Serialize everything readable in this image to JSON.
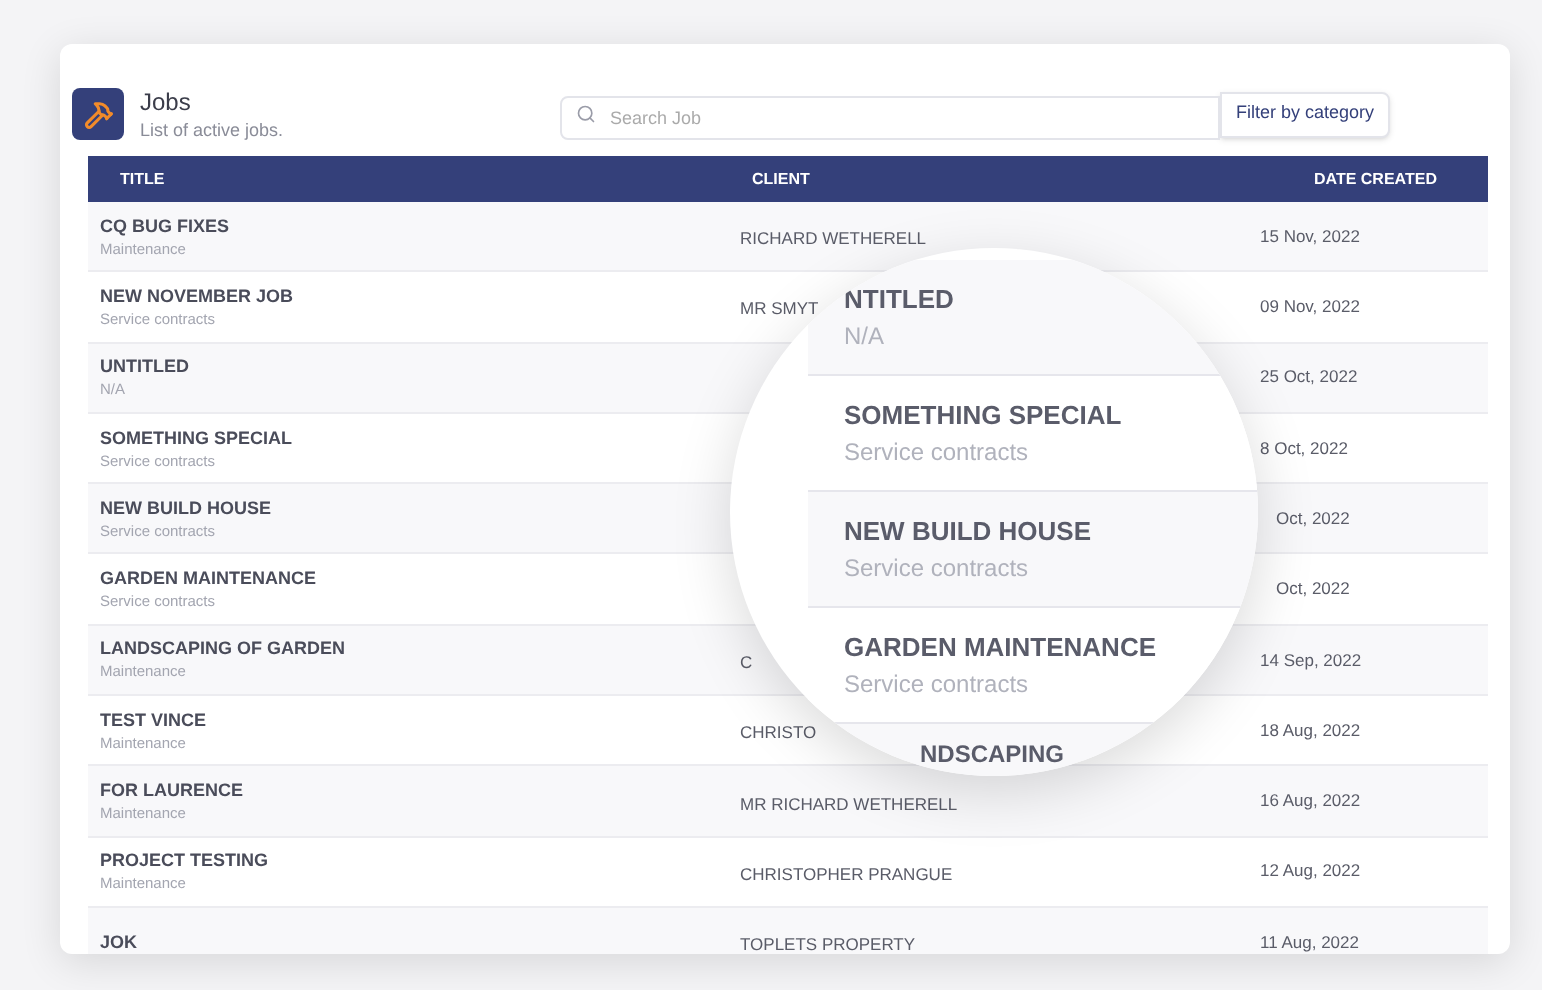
{
  "header": {
    "title": "Jobs",
    "subtitle": "List of active jobs."
  },
  "search": {
    "placeholder": "Search Job"
  },
  "filter_button": "Filter by category",
  "table": {
    "columns": [
      "TITLE",
      "CLIENT",
      "DATE CREATED"
    ],
    "rows": [
      {
        "title": "CQ BUG FIXES",
        "category": "Maintenance",
        "client": "RICHARD WETHERELL",
        "date": "15 Nov, 2022"
      },
      {
        "title": "NEW NOVEMBER JOB",
        "category": "Service contracts",
        "client": "MR SMYT",
        "date": "09 Nov, 2022"
      },
      {
        "title": "UNTITLED",
        "category": "N/A",
        "date": "25 Oct, 2022"
      },
      {
        "title": "SOMETHING SPECIAL",
        "category": "Service contracts",
        "date": "8 Oct, 2022"
      },
      {
        "title": "NEW BUILD HOUSE",
        "category": "Service contracts",
        "date": "Oct, 2022"
      },
      {
        "title": "GARDEN MAINTENANCE",
        "category": "Service contracts",
        "date": "Oct, 2022"
      },
      {
        "title": "LANDSCAPING OF GARDEN",
        "category": "Maintenance",
        "client": "C",
        "date": "14 Sep, 2022"
      },
      {
        "title": "TEST VINCE",
        "category": "Maintenance",
        "client": "CHRISTO",
        "date": "18 Aug, 2022"
      },
      {
        "title": "FOR LAURENCE",
        "category": "Maintenance",
        "client": "MR RICHARD WETHERELL",
        "date": "16 Aug, 2022"
      },
      {
        "title": "PROJECT TESTING",
        "category": "Maintenance",
        "client": "CHRISTOPHER PRANGUE",
        "date": "12 Aug, 2022"
      },
      {
        "title": "JOK",
        "client": "TOPLETS PROPERTY",
        "date": "11 Aug, 2022"
      }
    ]
  },
  "magnifier": {
    "rows": [
      {
        "title": "NTITLED",
        "category": "N/A"
      },
      {
        "title": "SOMETHING SPECIAL",
        "category": "Service contracts"
      },
      {
        "title": "NEW BUILD HOUSE",
        "category": "Service contracts"
      },
      {
        "title": "GARDEN MAINTENANCE",
        "category": "Service contracts"
      },
      {
        "title": "NDSCAPING"
      }
    ]
  }
}
